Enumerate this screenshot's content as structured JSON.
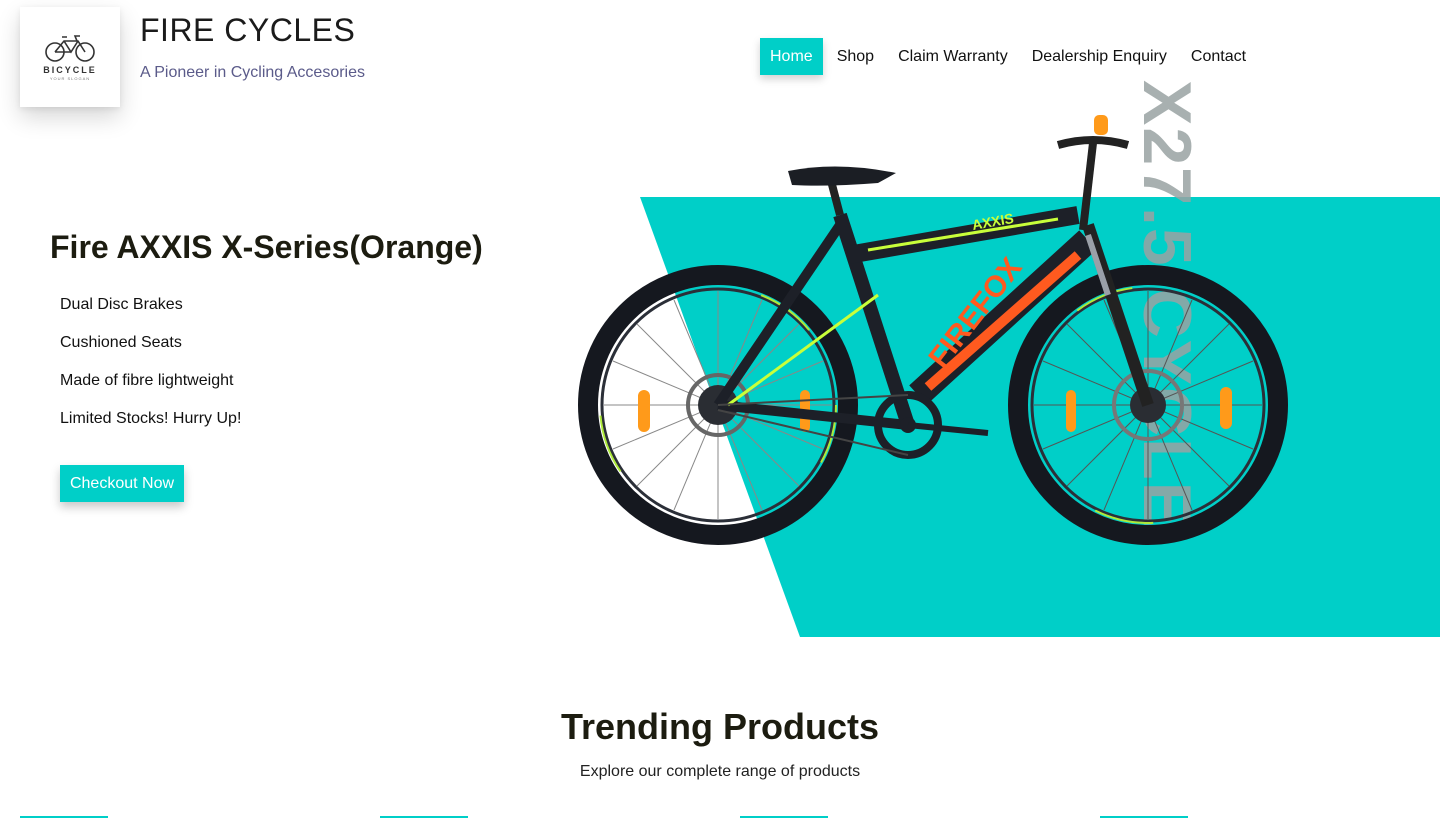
{
  "brand": {
    "logo_word": "BICYCLE",
    "logo_sub": "YOUR SLOGAN",
    "title": "FIRE CYCLES",
    "tagline": "A Pioneer in Cycling Accesories"
  },
  "nav": {
    "items": [
      {
        "label": "Home",
        "active": true
      },
      {
        "label": "Shop",
        "active": false
      },
      {
        "label": "Claim Warranty",
        "active": false
      },
      {
        "label": "Dealership Enquiry",
        "active": false
      },
      {
        "label": "Contact",
        "active": false
      }
    ]
  },
  "hero": {
    "title": "Fire AXXIS X-Series(Orange)",
    "features": [
      "Dual Disc Brakes",
      "Cushioned Seats",
      "Made of fibre lightweight",
      "Limited Stocks! Hurry Up!"
    ],
    "cta_label": "Checkout Now",
    "vertical_text": "X27.5 CYCLE",
    "bike_frame_text": "FIREFOX",
    "bike_bar_text": "AXXIS"
  },
  "trending": {
    "title": "Trending Products",
    "subtitle": "Explore our complete range of products"
  },
  "colors": {
    "accent": "#00cfc8",
    "tagline": "#5b5b8a",
    "bike_orange": "#ff5a1f",
    "bike_green": "#c8ff3a"
  },
  "icons": {
    "logo": "bicycle-logo-icon",
    "product": "bicycle-image"
  }
}
